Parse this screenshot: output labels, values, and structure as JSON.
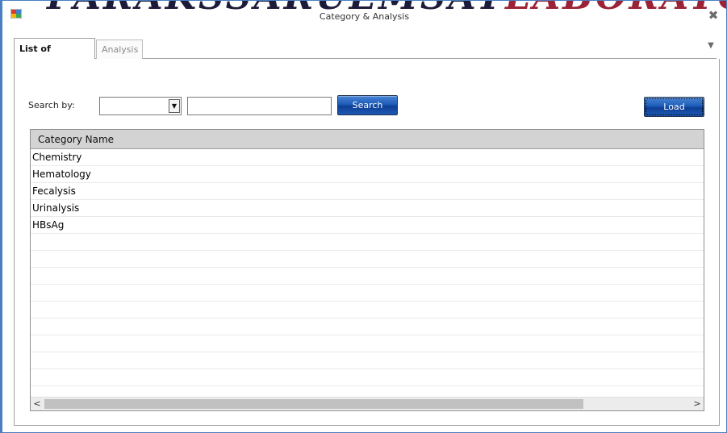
{
  "window": {
    "title": "Category & Analysis",
    "banner_dark": "PARAKSSARUEMSAT",
    "banner_red": "LABORATORY"
  },
  "tabs": [
    {
      "label": "List of Category",
      "active": true
    },
    {
      "label": "Analysis",
      "active": false
    }
  ],
  "toolbar": {
    "search_by_label": "Search by:",
    "combo_value": "",
    "search_value": "",
    "search_button": "Search",
    "load_button": "Load"
  },
  "grid": {
    "column_header": "Category Name",
    "rows": [
      "Chemistry",
      "Hematology",
      "Fecalysis",
      "Urinalysis",
      "HBsAg",
      "",
      "",
      "",
      "",
      "",
      "",
      "",
      "",
      "",
      ""
    ]
  },
  "scrollbar": {
    "left_arrow": "<",
    "right_arrow": ">"
  },
  "colors": {
    "accent": "#1d5db8",
    "window_border": "#4a7fc1",
    "grid_header": "#d3d3d3"
  },
  "icons": [
    "app-icon",
    "close-icon",
    "tab-dropdown-icon",
    "combo-arrow-icon"
  ]
}
